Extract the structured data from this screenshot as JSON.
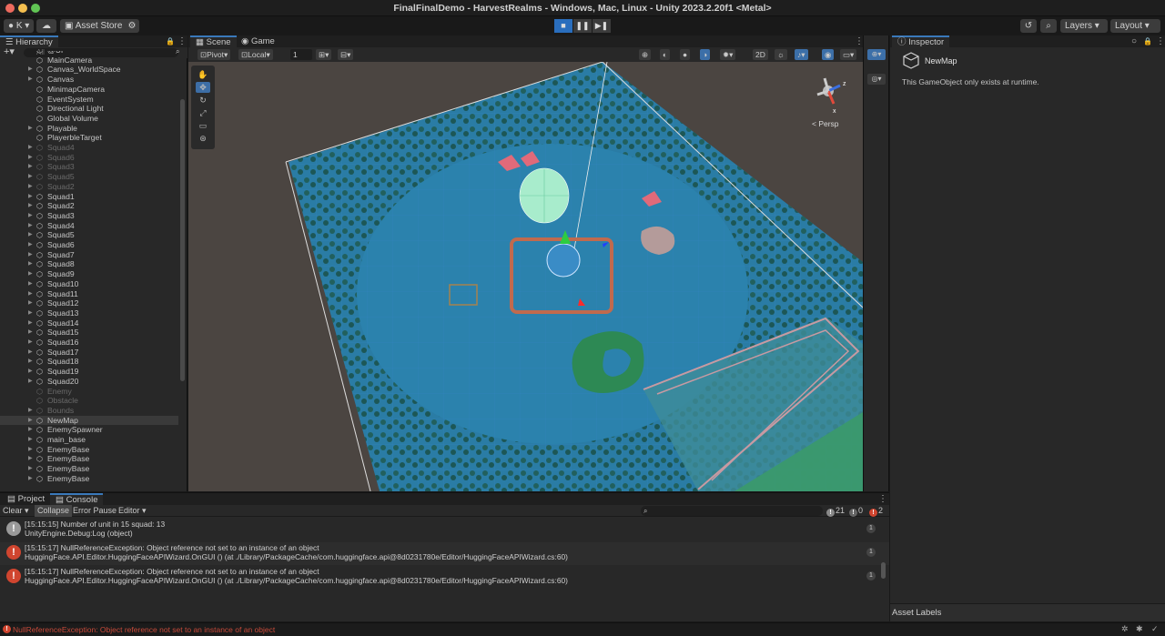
{
  "window": {
    "title": "FinalFinalDemo - HarvestRealms - Windows, Mac, Linux - Unity 2023.2.20f1 <Metal>"
  },
  "toolbar": {
    "account": "K",
    "asset_store": "Asset Store",
    "layers": "Layers",
    "layout": "Layout"
  },
  "hierarchy": {
    "tab": "Hierarchy",
    "search_placeholder": "All",
    "items": [
      {
        "label": "@UI",
        "dim": false,
        "arrow": false
      },
      {
        "label": "MainCamera",
        "dim": false,
        "arrow": false
      },
      {
        "label": "Canvas_WorldSpace",
        "dim": false,
        "arrow": true
      },
      {
        "label": "Canvas",
        "dim": false,
        "arrow": true
      },
      {
        "label": "MinimapCamera",
        "dim": false,
        "arrow": false
      },
      {
        "label": "EventSystem",
        "dim": false,
        "arrow": false
      },
      {
        "label": "Directional Light",
        "dim": false,
        "arrow": false
      },
      {
        "label": "Global Volume",
        "dim": false,
        "arrow": false
      },
      {
        "label": "Playable",
        "dim": false,
        "arrow": true
      },
      {
        "label": "PlayerbleTarget",
        "dim": false,
        "arrow": false
      },
      {
        "label": "Squad4",
        "dim": true,
        "arrow": true
      },
      {
        "label": "Squad6",
        "dim": true,
        "arrow": true
      },
      {
        "label": "Squad3",
        "dim": true,
        "arrow": true
      },
      {
        "label": "Squad5",
        "dim": true,
        "arrow": true
      },
      {
        "label": "Squad2",
        "dim": true,
        "arrow": true
      },
      {
        "label": "Squad1",
        "dim": false,
        "arrow": true
      },
      {
        "label": "Squad2",
        "dim": false,
        "arrow": true
      },
      {
        "label": "Squad3",
        "dim": false,
        "arrow": true
      },
      {
        "label": "Squad4",
        "dim": false,
        "arrow": true
      },
      {
        "label": "Squad5",
        "dim": false,
        "arrow": true
      },
      {
        "label": "Squad6",
        "dim": false,
        "arrow": true
      },
      {
        "label": "Squad7",
        "dim": false,
        "arrow": true
      },
      {
        "label": "Squad8",
        "dim": false,
        "arrow": true
      },
      {
        "label": "Squad9",
        "dim": false,
        "arrow": true
      },
      {
        "label": "Squad10",
        "dim": false,
        "arrow": true
      },
      {
        "label": "Squad11",
        "dim": false,
        "arrow": true
      },
      {
        "label": "Squad12",
        "dim": false,
        "arrow": true
      },
      {
        "label": "Squad13",
        "dim": false,
        "arrow": true
      },
      {
        "label": "Squad14",
        "dim": false,
        "arrow": true
      },
      {
        "label": "Squad15",
        "dim": false,
        "arrow": true
      },
      {
        "label": "Squad16",
        "dim": false,
        "arrow": true
      },
      {
        "label": "Squad17",
        "dim": false,
        "arrow": true
      },
      {
        "label": "Squad18",
        "dim": false,
        "arrow": true
      },
      {
        "label": "Squad19",
        "dim": false,
        "arrow": true
      },
      {
        "label": "Squad20",
        "dim": false,
        "arrow": true
      },
      {
        "label": "Enemy",
        "dim": true,
        "arrow": false
      },
      {
        "label": "Obstacle",
        "dim": true,
        "arrow": false
      },
      {
        "label": "Bounds",
        "dim": true,
        "arrow": true
      },
      {
        "label": "NewMap",
        "dim": false,
        "arrow": true,
        "selected": true
      },
      {
        "label": "EnemySpawner",
        "dim": false,
        "arrow": true
      },
      {
        "label": "main_base",
        "dim": false,
        "arrow": true
      },
      {
        "label": "EnemyBase",
        "dim": false,
        "arrow": true
      },
      {
        "label": "EnemyBase",
        "dim": false,
        "arrow": true
      },
      {
        "label": "EnemyBase",
        "dim": false,
        "arrow": true
      },
      {
        "label": "EnemyBase",
        "dim": false,
        "arrow": true
      }
    ]
  },
  "scene": {
    "tabs": [
      "Scene",
      "Game"
    ],
    "pivot": "Pivot",
    "local": "Local",
    "grid_value": "1",
    "mode_2d": "2D",
    "persp_label": "Persp"
  },
  "inspector": {
    "tab": "Inspector",
    "object_name": "NewMap",
    "message": "This GameObject only exists at runtime.",
    "asset_labels": "Asset Labels"
  },
  "console": {
    "tabs": [
      "Project",
      "Console"
    ],
    "clear": "Clear",
    "collapse": "Collapse",
    "error_pause": "Error Pause",
    "editor": "Editor",
    "counts": {
      "info": "21",
      "warn": "0",
      "error": "2"
    },
    "entries": [
      {
        "type": "info",
        "line1": "[15:15:15] Number of unit in 15 squad: 13",
        "line2": "UnityEngine.Debug:Log (object)",
        "count": "1"
      },
      {
        "type": "error",
        "line1": "[15:15:17] NullReferenceException: Object reference not set to an instance of an object",
        "line2": "HuggingFace.API.Editor.HuggingFaceAPIWizard.OnGUI () (at ./Library/PackageCache/com.huggingface.api@8d0231780e/Editor/HuggingFaceAPIWizard.cs:60)",
        "count": "1"
      },
      {
        "type": "error",
        "line1": "[15:15:17] NullReferenceException: Object reference not set to an instance of an object",
        "line2": "HuggingFace.API.Editor.HuggingFaceAPIWizard.OnGUI () (at ./Library/PackageCache/com.huggingface.api@8d0231780e/Editor/HuggingFaceAPIWizard.cs:60)",
        "count": "1"
      }
    ]
  },
  "statusbar": {
    "message": "NullReferenceException: Object reference not set to an instance of an object"
  },
  "colors": {
    "accent": "#3a79bb",
    "error": "#d0452f",
    "water": "#2b7ea6",
    "forest": "#1d5c52"
  }
}
